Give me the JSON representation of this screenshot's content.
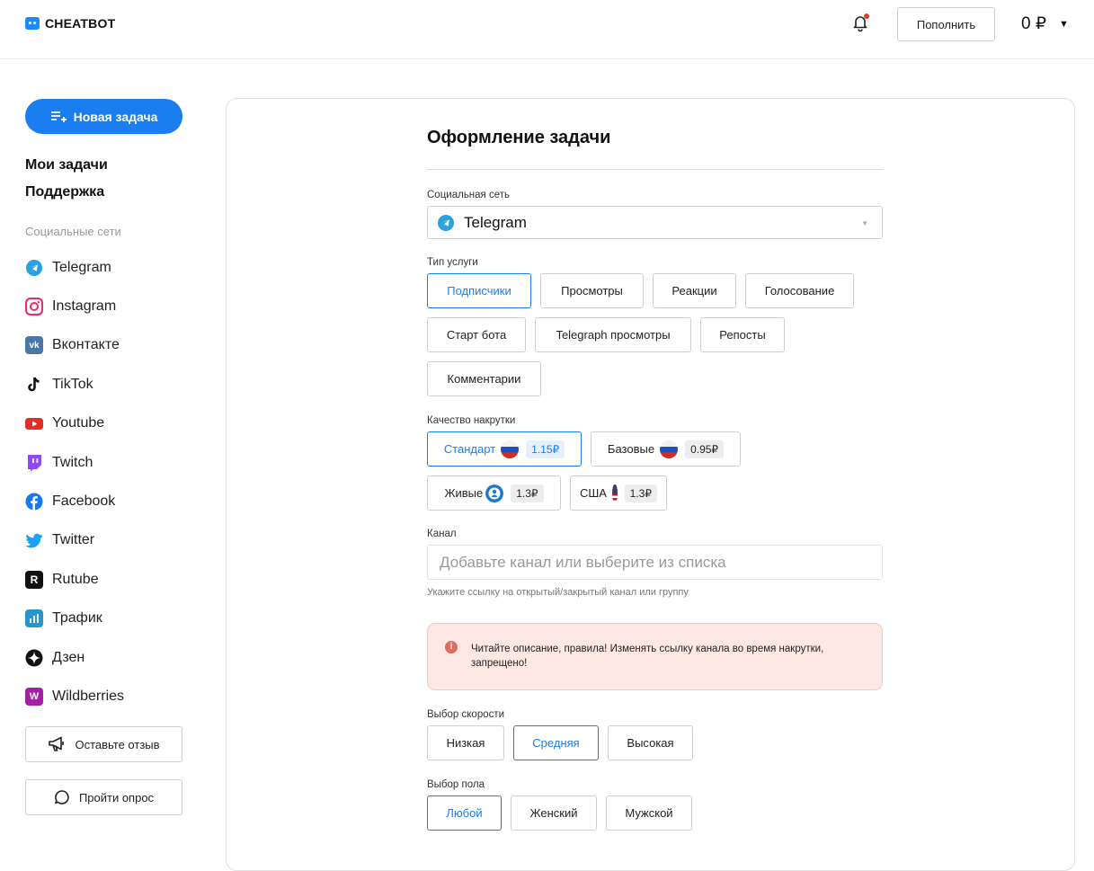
{
  "header": {
    "logo_text": "CHEATBOT",
    "topup_label": "Пополнить",
    "balance": "0 ₽",
    "has_notification_dot": true
  },
  "sidebar": {
    "new_task_label": "Новая задача",
    "nav": [
      {
        "label": "Мои задачи"
      },
      {
        "label": "Поддержка"
      }
    ],
    "social_title": "Социальные сети",
    "socials": [
      {
        "label": "Telegram",
        "icon": "telegram-icon"
      },
      {
        "label": "Instagram",
        "icon": "instagram-icon"
      },
      {
        "label": "Вконтакте",
        "icon": "vk-icon"
      },
      {
        "label": "TikTok",
        "icon": "tiktok-icon"
      },
      {
        "label": "Youtube",
        "icon": "youtube-icon"
      },
      {
        "label": "Twitch",
        "icon": "twitch-icon"
      },
      {
        "label": "Facebook",
        "icon": "facebook-icon"
      },
      {
        "label": "Twitter",
        "icon": "twitter-icon"
      },
      {
        "label": "Rutube",
        "icon": "rutube-icon"
      },
      {
        "label": "Трафик",
        "icon": "traffic-icon"
      },
      {
        "label": "Дзен",
        "icon": "dzen-icon"
      },
      {
        "label": "Wildberries",
        "icon": "wildberries-icon"
      }
    ],
    "feedback_label": "Оставьте отзыв",
    "survey_label": "Пройти опрос"
  },
  "form": {
    "title": "Оформление задачи",
    "network_label": "Социальная сеть",
    "network_value": "Telegram",
    "service_label": "Тип услуги",
    "services": [
      {
        "label": "Подписчики",
        "active": true
      },
      {
        "label": "Просмотры",
        "active": false
      },
      {
        "label": "Реакции",
        "active": false
      },
      {
        "label": "Голосование",
        "active": false
      },
      {
        "label": "Старт бота",
        "active": false
      },
      {
        "label": "Telegraph просмотры",
        "active": false
      },
      {
        "label": "Репосты",
        "active": false
      },
      {
        "label": "Комментарии",
        "active": false
      }
    ],
    "quality_label": "Качество накрутки",
    "qualities": [
      {
        "label": "Стандарт",
        "flag": "ru-flag-icon",
        "price": "1.15₽",
        "active": true
      },
      {
        "label": "Базовые",
        "flag": "ru-flag-icon",
        "price": "0.95₽",
        "active": false
      },
      {
        "label": "Живые",
        "flag": "live-user-icon",
        "price": "1.3₽",
        "active": false
      },
      {
        "label": "США",
        "flag": "us-flag-icon",
        "price": "1.3₽",
        "active": false
      }
    ],
    "channel_label": "Канал",
    "channel_placeholder": "Добавьте канал или выберите из списка",
    "channel_hint": "Укажите ссылку на открытый/закрытый канал или группу",
    "alert_text": "Читайте описание, правила! Изменять ссылку канала во время накрутки, запрещено!",
    "speed_label": "Выбор скорости",
    "speeds": [
      {
        "label": "Низкая",
        "active": false
      },
      {
        "label": "Средняя",
        "active": true
      },
      {
        "label": "Высокая",
        "active": false
      }
    ],
    "gender_label": "Выбор пола",
    "genders": [
      {
        "label": "Любой",
        "active": true
      },
      {
        "label": "Женский",
        "active": false
      },
      {
        "label": "Мужской",
        "active": false
      }
    ]
  }
}
